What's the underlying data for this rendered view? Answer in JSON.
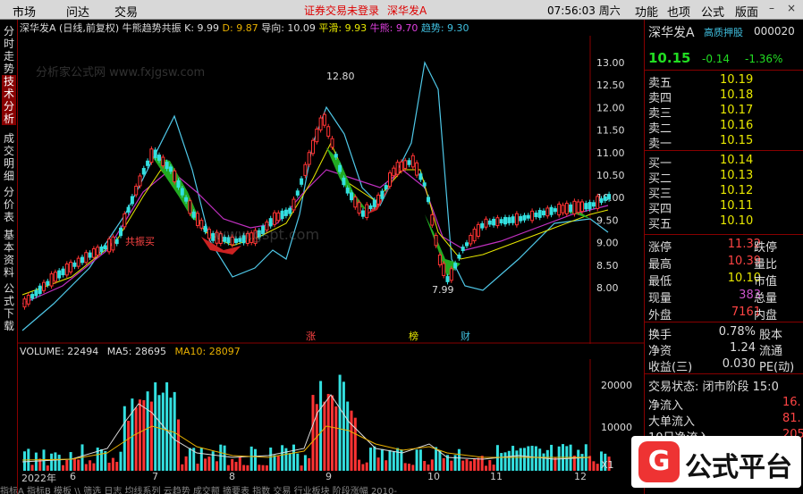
{
  "menu": {
    "items": [
      "市场",
      "问达",
      "交易"
    ],
    "notice_login": "证券交易未登录",
    "notice_stock": "深华发A",
    "clock": "07:56:03 周六",
    "right_items": [
      "功能",
      "也项",
      "公式",
      "版面"
    ]
  },
  "sidetabs": [
    "分时走势",
    "技术分析",
    "成交明细",
    "分价表",
    "基本资料",
    "公式下载"
  ],
  "chart_header": {
    "title": "深华发A",
    "mode": "(日线,前复权)",
    "indicator": "牛熊趋势共振",
    "k": "K: 9.99",
    "d": "D: 9.87",
    "guide": "导向: 10.09",
    "smooth": "平滑: 9.93",
    "bull": "牛熊: 9.70",
    "trend": "趋势: 9.30"
  },
  "main_chart": {
    "price_labels": [
      "13.00",
      "12.50",
      "12.00",
      "11.50",
      "11.00",
      "10.50",
      "10.00",
      "9.50",
      "9.00",
      "8.50",
      "8.00"
    ],
    "high_label": "12.80",
    "low_label": "7.99",
    "buy_label": "共振买",
    "event_labels": [
      "涨",
      "榜",
      "财"
    ]
  },
  "volume": {
    "label": "VOLUME: 22494",
    "ma5": "MA5: 28695",
    "ma10": "MA10: 28097",
    "axis": [
      "20000",
      "10000"
    ],
    "unit": "X1"
  },
  "xaxis": [
    "2022年",
    "6",
    "7",
    "8",
    "9",
    "10",
    "11",
    "12"
  ],
  "footer_text": "指标A  指标B  模板  \\\\ 筛选  日志  均线系列  云趋势  成交额  摘要表  指数  交易  行业板块  阶段涨幅  2010-",
  "quote": {
    "name": "深华发A",
    "tag": "高质押股",
    "code": "000020",
    "price": "10.15",
    "change": "-0.14",
    "pct": "-1.36%",
    "asks": [
      {
        "label": "卖五",
        "price": "10.19"
      },
      {
        "label": "卖四",
        "price": "10.18"
      },
      {
        "label": "卖三",
        "price": "10.17"
      },
      {
        "label": "卖二",
        "price": "10.16"
      },
      {
        "label": "卖一",
        "price": "10.15"
      }
    ],
    "bids": [
      {
        "label": "买一",
        "price": "10.14"
      },
      {
        "label": "买二",
        "price": "10.13"
      },
      {
        "label": "买三",
        "price": "10.12"
      },
      {
        "label": "买四",
        "price": "10.11"
      },
      {
        "label": "买五",
        "price": "10.10"
      }
    ],
    "stats": [
      {
        "l": "涨停",
        "v": "11.32",
        "r": "跌停",
        "c": "#ff4444"
      },
      {
        "l": "最高",
        "v": "10.39",
        "r": "量比",
        "c": "#ff4444"
      },
      {
        "l": "最低",
        "v": "10.10",
        "r": "市值",
        "c": "#e8e800"
      },
      {
        "l": "现量",
        "v": "383",
        "r": "总量",
        "c": "#cc55cc"
      },
      {
        "l": "外盘",
        "v": "7161",
        "r": "内盘",
        "c": "#ff4444"
      }
    ],
    "stats2": [
      {
        "l": "换手",
        "v": "0.78%",
        "r": "股本"
      },
      {
        "l": "净资",
        "v": "1.24",
        "r": "流通"
      },
      {
        "l": "收益(三)",
        "v": "0.030",
        "r": "PE(动)"
      }
    ],
    "trade_state": "交易状态: 闭市阶段 15:0",
    "flows": [
      {
        "l": "净流入",
        "v": "16."
      },
      {
        "l": "大单流入",
        "v": "81."
      },
      {
        "l": "10日净流入",
        "v": "205"
      }
    ]
  },
  "watermarks": [
    "www.gspt.com",
    "分析家公式网 www.fxjgsw.com"
  ],
  "logo_text": "公式平台"
}
